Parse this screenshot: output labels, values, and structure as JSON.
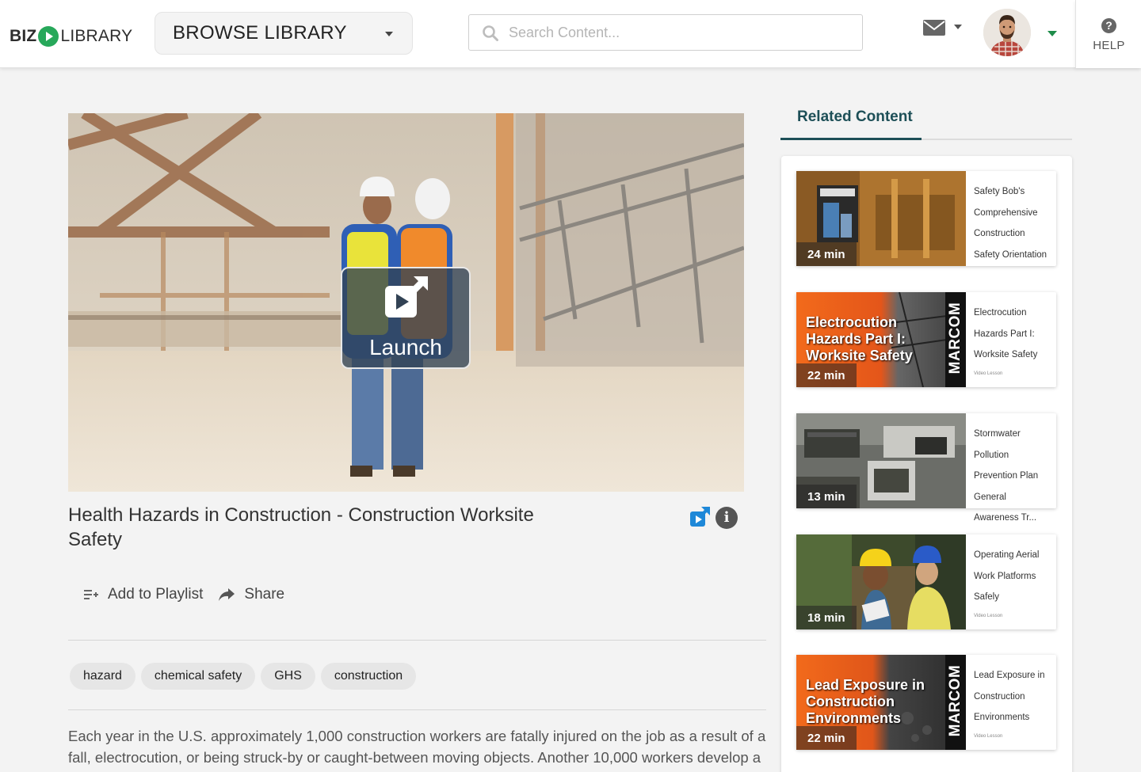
{
  "header": {
    "logo_biz": "BIZ",
    "logo_library": "LIBRARY",
    "browse_label": "BROWSE LIBRARY",
    "search_placeholder": "Search Content...",
    "help_label": "HELP"
  },
  "content": {
    "launch_label": "Launch",
    "title": "Health Hazards in Construction - Construction Worksite Safety",
    "actions": {
      "add_to_playlist": "Add to Playlist",
      "share": "Share"
    },
    "tags": [
      "hazard",
      "chemical safety",
      "GHS",
      "construction"
    ],
    "description": "Each year in the U.S. approximately 1,000 construction workers are fatally injured on the job as a result of a fall, electrocution, or being struck-by or caught-between moving objects. Another 10,000 workers develop a"
  },
  "related": {
    "tab_label": "Related Content",
    "items": [
      {
        "duration": "24 min",
        "title": "Safety Bob's Comprehensive Construction Safety Orientation",
        "type": "",
        "thumb_text": ""
      },
      {
        "duration": "22 min",
        "title": "Electrocution Hazards Part I: Worksite Safety",
        "type": "Video Lesson",
        "thumb_text": "Electrocution Hazards Part I: Worksite Safety",
        "brand": "MARCOM"
      },
      {
        "duration": "13 min",
        "title": "Stormwater Pollution Prevention Plan General Awareness Tr...",
        "type": "",
        "thumb_text": ""
      },
      {
        "duration": "18 min",
        "title": "Operating Aerial Work Platforms Safely",
        "type": "Video Lesson",
        "thumb_text": ""
      },
      {
        "duration": "22 min",
        "title": "Lead Exposure in Construction Environments",
        "type": "Video Lesson",
        "thumb_text": "Lead Exposure in Construction Environments",
        "brand": "MARCOM"
      }
    ]
  },
  "colors": {
    "brand_green": "#27a85a",
    "accent_teal": "#1d4f57",
    "launch_overlay": "#324254"
  }
}
